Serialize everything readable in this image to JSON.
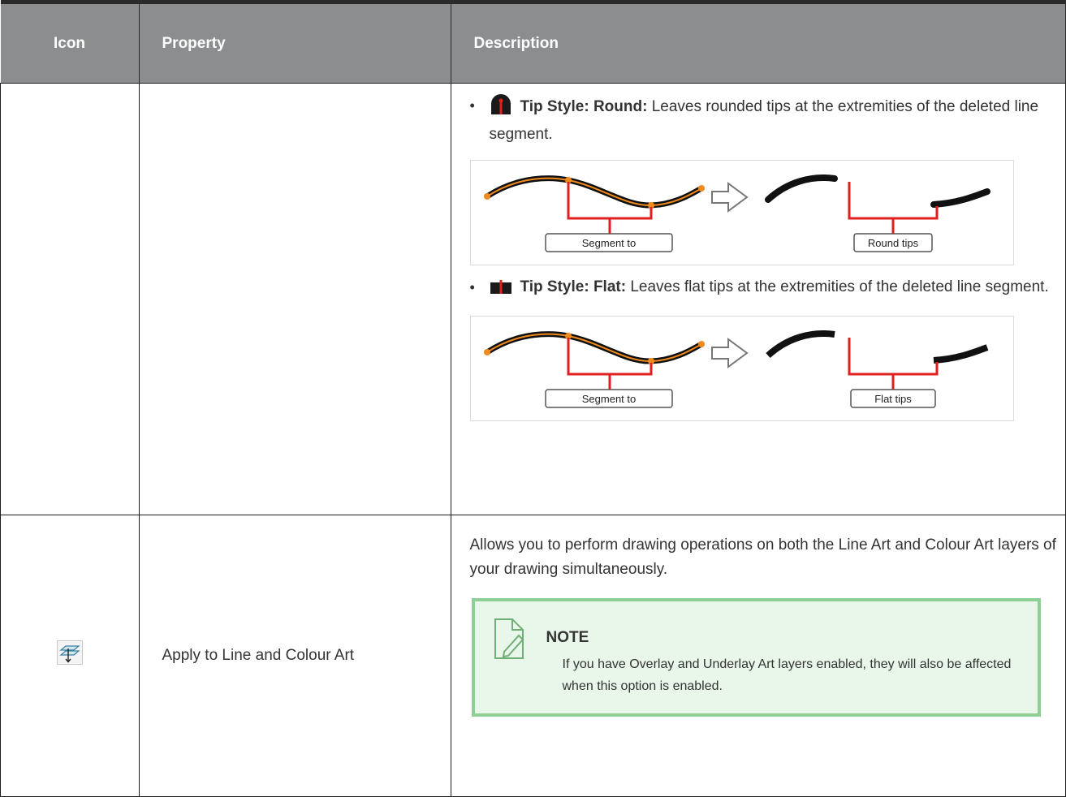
{
  "header": {
    "icon": "Icon",
    "property": "Property",
    "description": "Description"
  },
  "row1": {
    "round": {
      "label": "Tip Style: Round:",
      "text": " Leaves rounded tips at the extremities of the deleted line segment.",
      "fig_left": "Segment to",
      "fig_right": "Round tips"
    },
    "flat": {
      "label": "Tip Style: Flat:",
      "text": " Leaves flat tips at the extremities of the deleted line segment.",
      "fig_left": "Segment to",
      "fig_right": "Flat tips"
    }
  },
  "row2": {
    "icon": "apply-to-line-and-colour-icon",
    "property": "Apply to Line and Colour Art",
    "description": "Allows you to perform drawing operations on both the Line Art and Colour Art layers of your drawing simultaneously.",
    "note_title": "NOTE",
    "note_text": "If you have Overlay and Underlay Art layers enabled, they will also be affected when this option is enabled."
  },
  "colors": {
    "header_bg": "#8b8d8f",
    "note_bg": "#e9f7ea",
    "note_border": "#8fcf96",
    "accent_red": "#e11f1f",
    "accent_orange": "#f08a1c"
  }
}
